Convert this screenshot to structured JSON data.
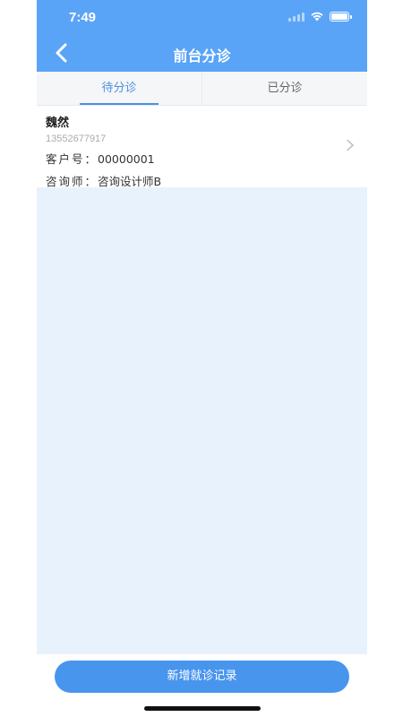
{
  "status_bar": {
    "time": "7:49"
  },
  "header": {
    "title": "前台分诊",
    "back_icon": "chevron-left-icon"
  },
  "tabs": [
    {
      "label": "待分诊",
      "active": true
    },
    {
      "label": "已分诊",
      "active": false
    }
  ],
  "patients": [
    {
      "name": "魏然",
      "phone": "13552677917",
      "customer_no_label": "客户号：",
      "customer_no": "00000001",
      "consultant_label": "咨询师：",
      "consultant": "咨询设计师B"
    }
  ],
  "footer": {
    "add_button_label": "新增就诊记录"
  },
  "colors": {
    "header": "#5aa4f8",
    "accent": "#4a90e2",
    "content_bg": "#e8f2fc",
    "button": "#4895ee"
  }
}
